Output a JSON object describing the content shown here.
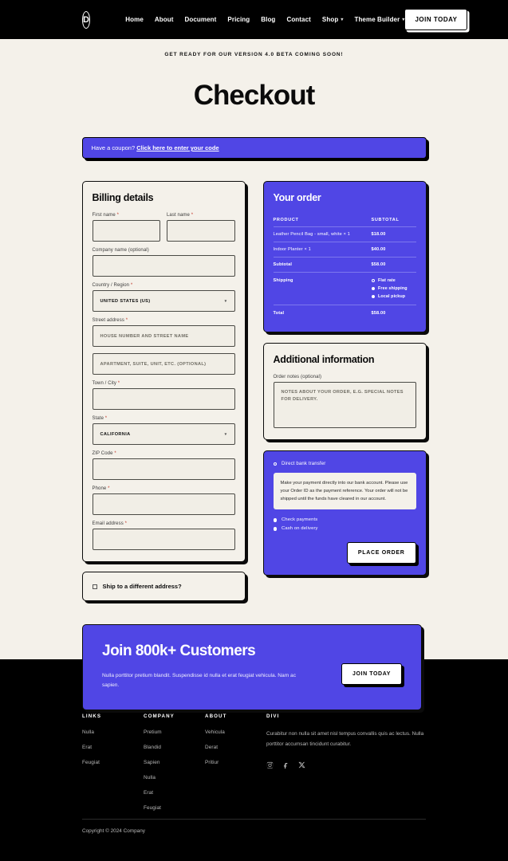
{
  "header": {
    "logo_letter": "D",
    "nav": [
      {
        "label": "Home",
        "dropdown": false
      },
      {
        "label": "About",
        "dropdown": false
      },
      {
        "label": "Document",
        "dropdown": false
      },
      {
        "label": "Pricing",
        "dropdown": false
      },
      {
        "label": "Blog",
        "dropdown": false
      },
      {
        "label": "Contact",
        "dropdown": false
      },
      {
        "label": "Shop",
        "dropdown": true
      },
      {
        "label": "Theme Builder",
        "dropdown": true
      }
    ],
    "cta_label": "JOIN TODAY",
    "caret": "▾"
  },
  "announcement": "GET READY FOR OUR VERSION 4.0 BETA COMING SOON!",
  "page_title": "Checkout",
  "coupon": {
    "text": "Have a coupon?",
    "link": "Click here to enter your code"
  },
  "billing": {
    "title": "Billing details",
    "first_name": {
      "label": "First name",
      "required": true,
      "value": ""
    },
    "last_name": {
      "label": "Last name",
      "required": true,
      "value": ""
    },
    "company": {
      "label": "Company name (optional)",
      "required": false,
      "value": ""
    },
    "country": {
      "label": "Country / Region",
      "required": true,
      "value": "UNITED STATES (US)"
    },
    "street": {
      "label": "Street address",
      "required": true,
      "placeholder": "HOUSE NUMBER AND STREET NAME"
    },
    "street2": {
      "placeholder": "APARTMENT, SUITE, UNIT, ETC. (OPTIONAL)"
    },
    "city": {
      "label": "Town / City",
      "required": true,
      "value": ""
    },
    "state": {
      "label": "State",
      "required": true,
      "value": "CALIFORNIA"
    },
    "zip": {
      "label": "ZIP Code",
      "required": true,
      "value": ""
    },
    "phone": {
      "label": "Phone",
      "required": true,
      "value": ""
    },
    "email": {
      "label": "Email address",
      "required": true,
      "value": ""
    },
    "required_mark": "*"
  },
  "ship_different": {
    "label": "Ship to a different address?",
    "checked": false
  },
  "order": {
    "title": "Your order",
    "col_product": "PRODUCT",
    "col_subtotal": "SUBTOTAL",
    "items": [
      {
        "name": "Leather Pencil Bag - small, white  × 1",
        "price": "$18.00"
      },
      {
        "name": "Indoor Planter  × 1",
        "price": "$40.00"
      }
    ],
    "subtotal_label": "Subtotal",
    "subtotal_value": "$58.00",
    "shipping_label": "Shipping",
    "shipping_options": [
      {
        "label": "Flat rate",
        "selected": true
      },
      {
        "label": "Free shipping",
        "selected": false
      },
      {
        "label": "Local pickup",
        "selected": false
      }
    ],
    "total_label": "Total",
    "total_value": "$58.00"
  },
  "additional": {
    "title": "Additional information",
    "notes_label": "Order notes (optional)",
    "notes_placeholder": "NOTES ABOUT YOUR ORDER, E.G. SPECIAL NOTES FOR DELIVERY."
  },
  "payment": {
    "methods": [
      {
        "label": "Direct bank transfer",
        "selected": true
      },
      {
        "label": "Check payments",
        "selected": false
      },
      {
        "label": "Cash on delivery",
        "selected": false
      }
    ],
    "description": "Make your payment directly into our bank account. Please use your Order ID as the payment reference. Your order will not be shipped until the funds have cleared in our account.",
    "place_order_label": "PLACE ORDER"
  },
  "cta": {
    "title": "Join 800k+ Customers",
    "text": "Nulla porttitor pretium blandit. Suspendisse id nulla et erat feugiat vehicula. Nam ac sapien.",
    "button": "JOIN TODAY"
  },
  "footer": {
    "columns": [
      {
        "heading": "LINKS",
        "links": [
          "Nulla",
          "Erat",
          "Feugiat"
        ]
      },
      {
        "heading": "COMPANY",
        "links": [
          "Pretium",
          "Blandid",
          "Sapien",
          "Nulla",
          "Erat",
          "Feugiat"
        ]
      },
      {
        "heading": "ABOUT",
        "links": [
          "Vehicula",
          "Derat",
          "Pritiur"
        ]
      }
    ],
    "divi": {
      "heading": "DIVI",
      "description": "Curabitur non nulla sit amet nisl tempus convallis quis ac lectus. Nulla porttitor accumsan tincidunt curabitur.",
      "socials": [
        "instagram-icon",
        "facebook-icon",
        "x-icon"
      ]
    },
    "copyright": "Copyright © 2024 Company"
  },
  "colors": {
    "accent": "#5046e5",
    "background": "#f4f1ea",
    "dark": "#000000",
    "required": "#c0392b"
  }
}
